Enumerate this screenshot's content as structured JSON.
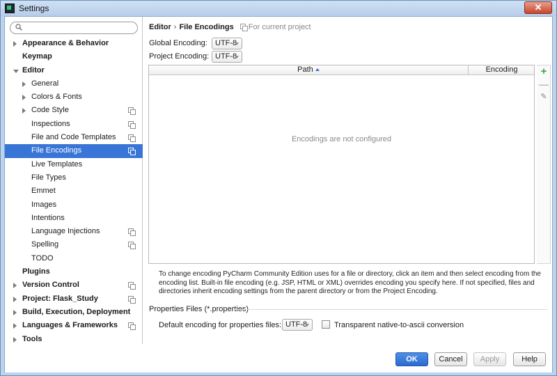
{
  "window": {
    "title": "Settings"
  },
  "search": {
    "placeholder": "",
    "value": ""
  },
  "tree": [
    {
      "label": "Appearance & Behavior",
      "level": 0,
      "bold": true,
      "arrow": "right",
      "copy": false,
      "selected": false
    },
    {
      "label": "Keymap",
      "level": 0,
      "bold": true,
      "arrow": "none",
      "copy": false,
      "selected": false
    },
    {
      "label": "Editor",
      "level": 0,
      "bold": true,
      "arrow": "down",
      "copy": false,
      "selected": false
    },
    {
      "label": "General",
      "level": 1,
      "bold": false,
      "arrow": "right",
      "copy": false,
      "selected": false
    },
    {
      "label": "Colors & Fonts",
      "level": 1,
      "bold": false,
      "arrow": "right",
      "copy": false,
      "selected": false
    },
    {
      "label": "Code Style",
      "level": 1,
      "bold": false,
      "arrow": "right",
      "copy": true,
      "selected": false
    },
    {
      "label": "Inspections",
      "level": 1,
      "bold": false,
      "arrow": "none",
      "copy": true,
      "selected": false
    },
    {
      "label": "File and Code Templates",
      "level": 1,
      "bold": false,
      "arrow": "none",
      "copy": true,
      "selected": false
    },
    {
      "label": "File Encodings",
      "level": 1,
      "bold": false,
      "arrow": "none",
      "copy": true,
      "selected": true
    },
    {
      "label": "Live Templates",
      "level": 1,
      "bold": false,
      "arrow": "none",
      "copy": false,
      "selected": false
    },
    {
      "label": "File Types",
      "level": 1,
      "bold": false,
      "arrow": "none",
      "copy": false,
      "selected": false
    },
    {
      "label": "Emmet",
      "level": 1,
      "bold": false,
      "arrow": "none",
      "copy": false,
      "selected": false
    },
    {
      "label": "Images",
      "level": 1,
      "bold": false,
      "arrow": "none",
      "copy": false,
      "selected": false
    },
    {
      "label": "Intentions",
      "level": 1,
      "bold": false,
      "arrow": "none",
      "copy": false,
      "selected": false
    },
    {
      "label": "Language Injections",
      "level": 1,
      "bold": false,
      "arrow": "none",
      "copy": true,
      "selected": false
    },
    {
      "label": "Spelling",
      "level": 1,
      "bold": false,
      "arrow": "none",
      "copy": true,
      "selected": false
    },
    {
      "label": "TODO",
      "level": 1,
      "bold": false,
      "arrow": "none",
      "copy": false,
      "selected": false
    },
    {
      "label": "Plugins",
      "level": 0,
      "bold": true,
      "arrow": "none",
      "copy": false,
      "selected": false
    },
    {
      "label": "Version Control",
      "level": 0,
      "bold": true,
      "arrow": "right",
      "copy": true,
      "selected": false
    },
    {
      "label": "Project: Flask_Study",
      "level": 0,
      "bold": true,
      "arrow": "right",
      "copy": true,
      "selected": false
    },
    {
      "label": "Build, Execution, Deployment",
      "level": 0,
      "bold": true,
      "arrow": "right",
      "copy": false,
      "selected": false
    },
    {
      "label": "Languages & Frameworks",
      "level": 0,
      "bold": true,
      "arrow": "right",
      "copy": true,
      "selected": false
    },
    {
      "label": "Tools",
      "level": 0,
      "bold": true,
      "arrow": "right",
      "copy": false,
      "selected": false
    }
  ],
  "breadcrumb": {
    "parent": "Editor",
    "separator": "›",
    "current": "File Encodings",
    "scope": "For current project"
  },
  "global_encoding": {
    "label": "Global Encoding:",
    "value": "UTF-8"
  },
  "project_encoding": {
    "label": "Project Encoding:",
    "value": "UTF-8"
  },
  "table": {
    "columns": [
      "Path",
      "Encoding"
    ],
    "empty_text": "Encodings are not configured"
  },
  "toolbar": {
    "add": "+",
    "remove": "—",
    "edit": "✎"
  },
  "help_text": "To change encoding PyCharm Community Edition uses for a file or directory, click an item and then select encoding from the encoding list. Built-in file encoding (e.g. JSP, HTML or XML) overrides encoding you specify here. If not specified, files and directories inherit encoding settings from the parent directory or from the Project Encoding.",
  "properties": {
    "section_title": "Properties Files (*.properties)",
    "default_label": "Default encoding for properties files:",
    "default_value": "UTF-8",
    "transparent_label": "Transparent native-to-ascii conversion",
    "transparent_checked": false
  },
  "buttons": {
    "ok": "OK",
    "cancel": "Cancel",
    "apply": "Apply",
    "help": "Help"
  },
  "colors": {
    "selection": "#3875d7",
    "add_green": "#3aa83a",
    "ok_blue": "#2b6bd1"
  }
}
